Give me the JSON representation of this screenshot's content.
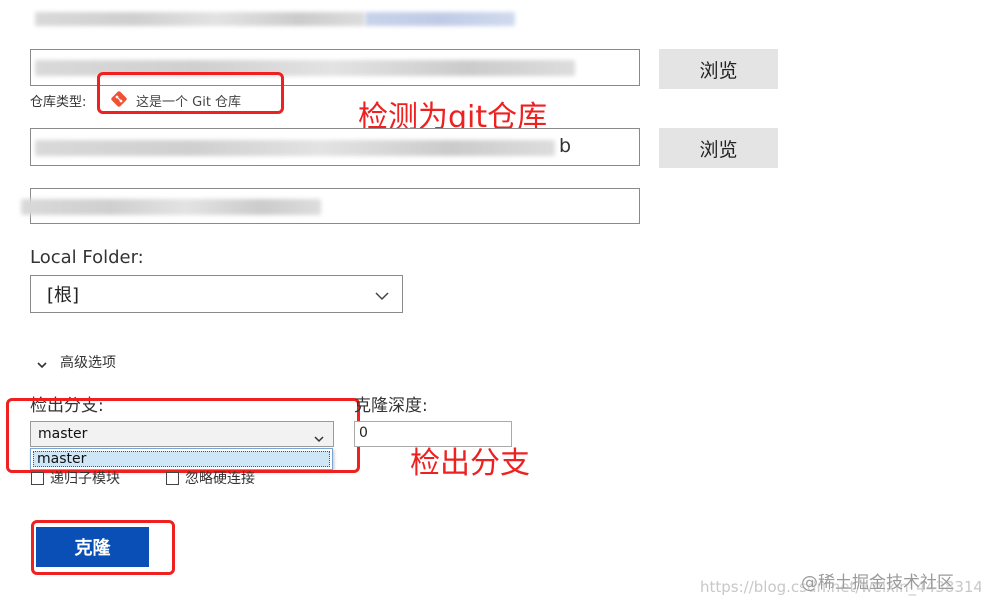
{
  "repo_type": {
    "label": "仓库类型:",
    "value": "这是一个 Git 仓库"
  },
  "browse_buttons": [
    "浏览",
    "浏览"
  ],
  "repo_url_tail": "b",
  "local_folder": {
    "label": "Local Folder:",
    "value": "[根]"
  },
  "advanced": {
    "label": "高级选项"
  },
  "checkout_branch": {
    "label": "检出分支:",
    "value": "master",
    "options": [
      "master"
    ]
  },
  "clone_depth": {
    "label": "克隆深度:",
    "value": "0"
  },
  "checkboxes": [
    {
      "label": "递归子模块",
      "checked": false
    },
    {
      "label": "忽略硬连接",
      "checked": false
    }
  ],
  "clone_button": "克隆",
  "annotations": {
    "git_detect": "检测为git仓库",
    "checkout": "检出分支"
  },
  "watermark": {
    "url": "https://blog.csdn.net/weixin_44383143",
    "site": "@稀土掘金技术社区"
  },
  "colors": {
    "accent": "#0a4fb5",
    "annotation_red": "#ee2020",
    "git_orange": "#f05133"
  }
}
